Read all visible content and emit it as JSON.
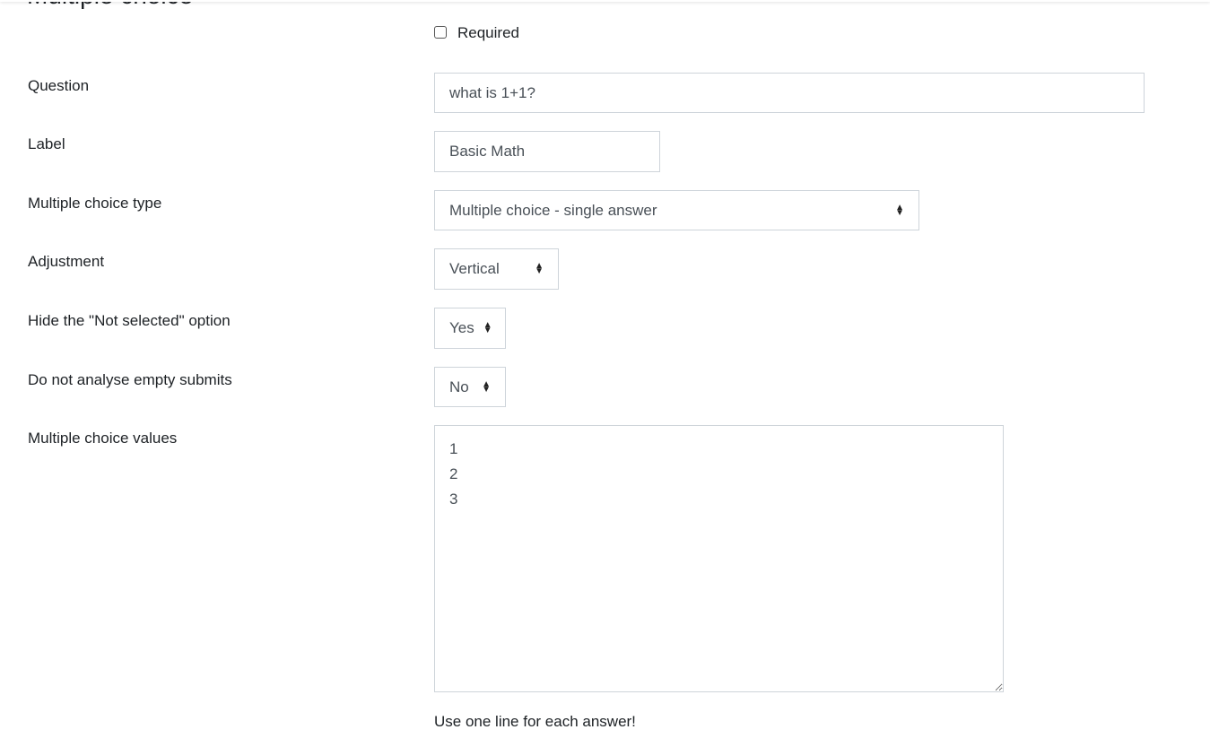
{
  "section_title": "Multiple choice",
  "required": {
    "label": "Required",
    "checked": false
  },
  "fields": {
    "question": {
      "label": "Question",
      "value": "what is 1+1?"
    },
    "label": {
      "label": "Label",
      "value": "Basic Math"
    },
    "mc_type": {
      "label": "Multiple choice type",
      "value": "Multiple choice - single answer"
    },
    "adjustment": {
      "label": "Adjustment",
      "value": "Vertical"
    },
    "hide_not_selected": {
      "label": "Hide the \"Not selected\" option",
      "value": "Yes"
    },
    "no_analyse_empty": {
      "label": "Do not analyse empty submits",
      "value": "No"
    },
    "values": {
      "label": "Multiple choice values",
      "value": "1\n2\n3",
      "help": "Use one line for each answer!"
    }
  }
}
